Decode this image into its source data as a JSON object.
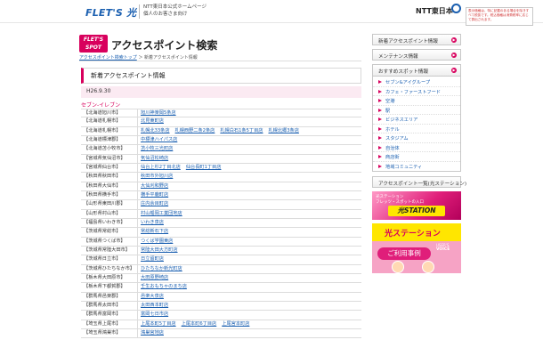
{
  "header": {
    "logo_text": "FLET'S",
    "logo_hikari": "光",
    "sub_line1": "NTT東日本公式ホームページ",
    "sub_line2": "個人のお客さま向け",
    "ntt_logo": "NTT東日本",
    "notice_text": "表示価格は、特に記載のある場合を除きすべて税抜です。税込価格は消費税率に応じて算出されます。"
  },
  "title": {
    "spot_logo_line1": "FLET'S",
    "spot_logo_line2": "SPOT",
    "page_title": "アクセスポイント検索"
  },
  "breadcrumb": {
    "link": "アクセスポイント検索トップ",
    "separator": "＞",
    "current": "新着アクセスポイント情報"
  },
  "section": {
    "title": "新着アクセスポイント情報",
    "date": "H26.9.30",
    "group": "セブン-イレブン"
  },
  "table": {
    "rows": [
      {
        "pref": "【北海道旭川市】",
        "stores": [
          "旭川神楽岡5条店"
        ]
      },
      {
        "pref": "【北海道札幌市】",
        "stores": [
          "北見東町店"
        ]
      },
      {
        "pref": "【北海道札幌市】",
        "stores": [
          "札幌北33条店",
          "札幌西野二条2条店",
          "札幌白石1条5丁目店",
          "札幌北郷3条店"
        ]
      },
      {
        "pref": "【北海道標津郡】",
        "stores": [
          "中標津ハイパス店"
        ]
      },
      {
        "pref": "【北海道苫小牧市】",
        "stores": [
          "苫小牧三光町店"
        ]
      },
      {
        "pref": "【宮城県気仙沼市】",
        "stores": [
          "気仙沼松崎店"
        ]
      },
      {
        "pref": "【宮城県仙台市】",
        "stores": [
          "仙台上杉2丁目北店",
          "仙台長町1丁目店"
        ]
      },
      {
        "pref": "【秋田県秋田市】",
        "stores": [
          "秋田市外旭川店"
        ]
      },
      {
        "pref": "【秋田県大仙市】",
        "stores": [
          "大仙刈和野店"
        ]
      },
      {
        "pref": "【秋田県横手市】",
        "stores": [
          "横手平鹿町店"
        ]
      },
      {
        "pref": "【山形県東田川郡】",
        "stores": [
          "庄内余目町店"
        ]
      },
      {
        "pref": "【山形県村山市】",
        "stores": [
          "村山楯岡工業団地店"
        ]
      },
      {
        "pref": "【福島県いわき市】",
        "stores": [
          "いわき泉店"
        ]
      },
      {
        "pref": "【茨城県常総市】",
        "stores": [
          "常総新石下店"
        ]
      },
      {
        "pref": "【茨城県つくば市】",
        "stores": [
          "つくば学園東店"
        ]
      },
      {
        "pref": "【茨城県常陸大田市】",
        "stores": [
          "常陸大田大方町店"
        ]
      },
      {
        "pref": "【茨城県日立市】",
        "stores": [
          "日立留町店"
        ]
      },
      {
        "pref": "【茨城県ひたちなか市】",
        "stores": [
          "ひたちなか新光町店"
        ]
      },
      {
        "pref": "【栃木県大田原市】",
        "stores": [
          "大田原野崎店"
        ]
      },
      {
        "pref": "【栃木県下都賀郡】",
        "stores": [
          "壬生おもちゃのまち店"
        ]
      },
      {
        "pref": "【群馬県邑楽郡】",
        "stores": [
          "邑楽大泉店"
        ]
      },
      {
        "pref": "【群馬県太田市】",
        "stores": [
          "太田西本町店"
        ]
      },
      {
        "pref": "【群馬県富岡市】",
        "stores": [
          "富岡七日市店"
        ]
      },
      {
        "pref": "【埼玉県上尾市】",
        "stores": [
          "上尾本町5丁目店",
          "上尾本町6丁目店",
          "上尾宮本町店"
        ]
      },
      {
        "pref": "【埼玉県鴻巣市】",
        "stores": [
          "鴻巣宮地店"
        ]
      }
    ]
  },
  "sidebar": {
    "btn_new": "新着アクセスポイント情報",
    "btn_maint": "メンテナンス情報",
    "osusume_title": "おすすめスポット情報",
    "osusume_items": [
      "セブン&アイグループ",
      "カフェ・ファーストフード",
      "空港",
      "駅",
      "ビジネスエリア",
      "ホテル",
      "スタジアム",
      "自治体",
      "商店街",
      "地域コミュニティ"
    ],
    "ap_list": "アクセスポイント一覧(光ステーション)",
    "banner1_top": "光ステーション",
    "banner1_mid": "フレッツ・スポットの入口",
    "banner1_station": "光STATION",
    "banner2_title": "光ステーション",
    "banner2_cta": "ご利用事例",
    "banner2_users": "USER'S",
    "banner2_voice": "VOICE"
  }
}
